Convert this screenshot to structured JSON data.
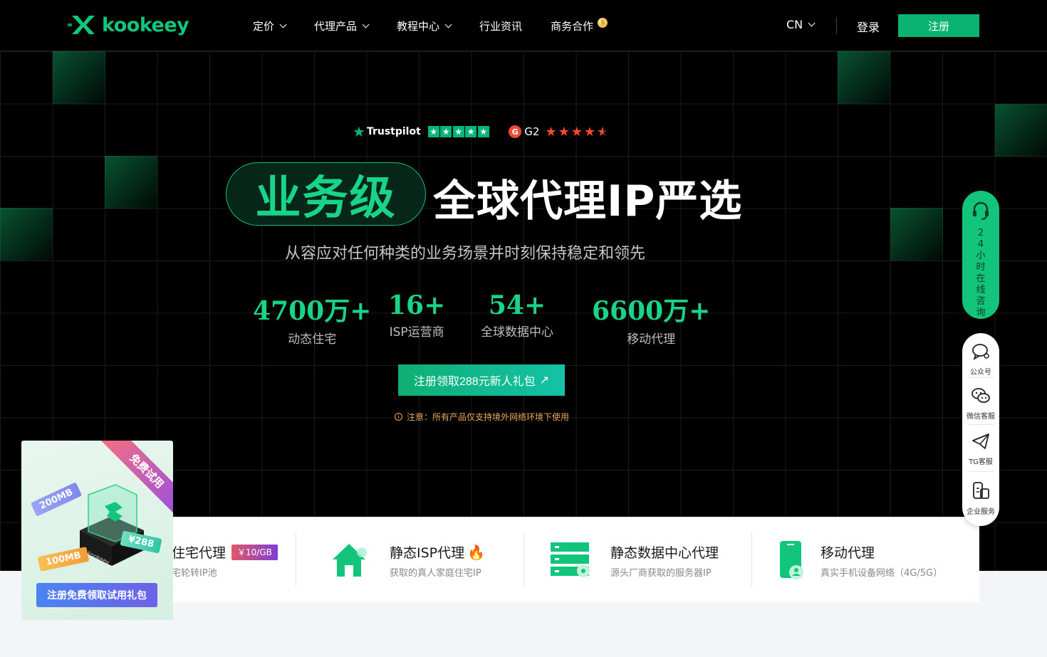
{
  "header": {
    "logo_text": "kookeey",
    "nav": [
      {
        "label": "定价",
        "has_dropdown": true
      },
      {
        "label": "代理产品",
        "has_dropdown": true
      },
      {
        "label": "教程中心",
        "has_dropdown": true
      },
      {
        "label": "行业资讯",
        "has_dropdown": false
      },
      {
        "label": "商务合作",
        "has_dropdown": false
      }
    ],
    "lang": "CN",
    "login": "登录",
    "register": "注册"
  },
  "ratings": {
    "trustpilot": "Trustpilot",
    "g2": "G2"
  },
  "hero": {
    "pill_text": "业务级",
    "headline": "全球代理IP严选",
    "subline": "从容应对任何种类的业务场景并时刻保持稳定和领先",
    "stats": [
      {
        "value": "4700万+",
        "label": "动态住宅"
      },
      {
        "value": "16+",
        "label": "ISP运营商"
      },
      {
        "value": "54+",
        "label": "全球数据中心"
      },
      {
        "value": "6600万+",
        "label": "移动代理"
      }
    ],
    "cta": "注册领取288元新人礼包",
    "notice": "注意：所有产品仅支持境外网络环境下使用"
  },
  "products": [
    {
      "title": "住宅代理",
      "price": "￥10/GB",
      "desc": "宅轮转IP池"
    },
    {
      "title": "静态ISP代理",
      "desc": "获取的真人家庭住宅IP"
    },
    {
      "title": "静态数据中心代理",
      "desc": "源头厂商获取的服务器IP"
    },
    {
      "title": "移动代理",
      "desc": "真实手机设备网络（4G/5G）"
    }
  ],
  "promo": {
    "ribbon": "免费试用",
    "chip_200": "200MB",
    "chip_288": "¥288",
    "chip_100": "100MB",
    "button": "注册免费领取试用礼包"
  },
  "float": {
    "consult": "24小时在线咨询",
    "items": [
      "公众号",
      "微信客服",
      "TG客服",
      "企业服务"
    ]
  },
  "colors": {
    "brand_green": "#13c57d",
    "accent_orange": "#e8a657"
  }
}
